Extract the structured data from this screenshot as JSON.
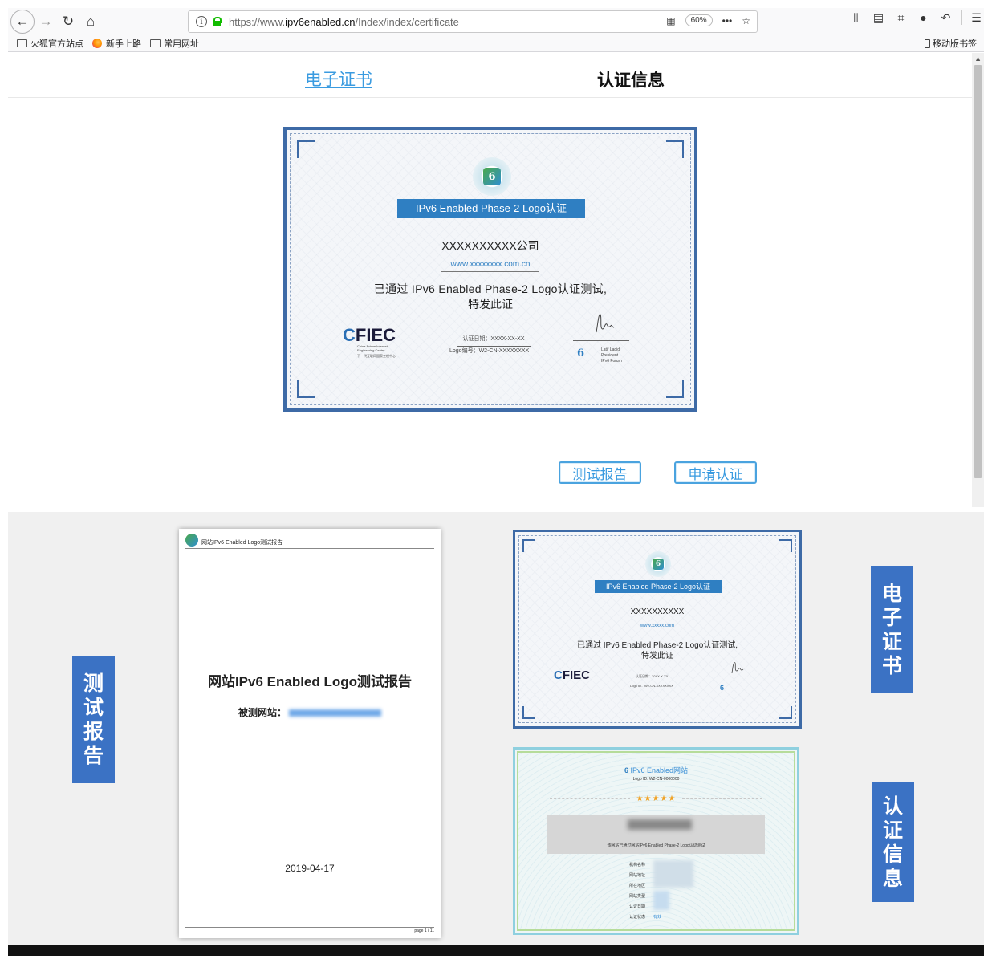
{
  "browser": {
    "url_prefix": "https://www.",
    "url_domain": "ipv6enabled.cn",
    "url_path": "/Index/index/certificate",
    "zoom": "60%",
    "bookmarks": [
      "火狐官方站点",
      "新手上路",
      "常用网址"
    ],
    "mobile_bookmarks": "移动版书签"
  },
  "tabs": {
    "certificate": "电子证书",
    "info": "认证信息"
  },
  "certificate": {
    "ribbon": "IPv6 Enabled Phase-2 Logo认证",
    "company": "XXXXXXXXXX公司",
    "website": "www.xxxxxxxx.com.cn",
    "statement_line1": "已通过 IPv6 Enabled Phase-2 Logo认证测试,",
    "statement_line2": "特发此证",
    "fieg": "FIEC",
    "fieg_sub": "China Future Internet Engineering Center",
    "fieg_cn": "下一代互联网国家工程中心",
    "date": "认证日期：XXXX-XX-XX",
    "logo_no": "Logo编号：W2-CN-XXXXXXXX",
    "signer_name": "Latif Ladid",
    "signer_title": "President",
    "signer_org": "IPv6 Forum"
  },
  "buttons": {
    "report": "测试报告",
    "apply": "申请认证"
  },
  "showcase": {
    "label_report": [
      "测",
      "试",
      "报",
      "告"
    ],
    "label_cert": [
      "电",
      "子",
      "证",
      "书"
    ],
    "label_info": [
      "认",
      "证",
      "信",
      "息"
    ],
    "report_header": "网站IPv6 Enabled Logo测试报告",
    "report_title": "网站IPv6 Enabled Logo测试报告",
    "report_site_label": "被测网站：",
    "report_date": "2019-04-17",
    "report_page": "page 1 / 11",
    "small_cert": {
      "ribbon": "IPv6 Enabled Phase-2 Logo认证",
      "company": "XXXXXXXXXX",
      "website": "www.xxxxx.com",
      "statement_line1": "已通过 IPv6 Enabled Phase-2 Logo认证测试,",
      "statement_line2": "特发此证",
      "fieg": "FIEC",
      "date": "认证日期：20XX-X-XX",
      "logo_no": "Logo ID：W2-CN-XXXXXXXX"
    },
    "info_cert": {
      "title": "IPv6 Enabled网站",
      "logo_id": "Logo ID: W2-CN-0000000",
      "stars": "★★★★★",
      "pass_text": "该网站已通过网站IPv6 Enabled Phase-2 Logo认证测试",
      "rows": [
        "机构名称",
        "网站地址",
        "所在地区",
        "网站类型",
        "认证日期",
        "认证状态"
      ],
      "status": "有效"
    }
  },
  "colors": {
    "accent": "#3a9be0",
    "cert_border": "#3d6aa6",
    "ribbon": "#2f7fc2",
    "label_bg": "#3b72c4"
  }
}
